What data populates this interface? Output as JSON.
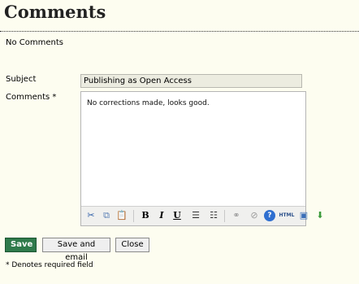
{
  "page": {
    "title": "Comments",
    "empty_message": "No Comments"
  },
  "form": {
    "subject_label": "Subject",
    "subject_value": "Publishing as Open Access",
    "comments_label": "Comments *",
    "comments_value": "No corrections made, looks good."
  },
  "editor_toolbar": {
    "buttons": [
      {
        "name": "cut",
        "icon": "scissors-icon",
        "glyph": "✂",
        "color": "#2f5fa8"
      },
      {
        "name": "copy",
        "icon": "copy-icon",
        "glyph": "⧉",
        "color": "#5a7fb5"
      },
      {
        "name": "paste",
        "icon": "paste-icon",
        "glyph": "📋",
        "color": "#b08a3a"
      },
      {
        "name": "bold",
        "icon": "bold-icon",
        "glyph": "B",
        "color": "#000000"
      },
      {
        "name": "italic",
        "icon": "italic-icon",
        "glyph": "I",
        "color": "#000000"
      },
      {
        "name": "underline",
        "icon": "underline-icon",
        "glyph": "U",
        "color": "#000000"
      },
      {
        "name": "bullet-list",
        "icon": "bullet-list-icon",
        "glyph": "☰",
        "color": "#333333"
      },
      {
        "name": "numbered-list",
        "icon": "numbered-list-icon",
        "glyph": "☷",
        "color": "#333333"
      },
      {
        "name": "link",
        "icon": "link-icon",
        "glyph": "⚭",
        "color": "#9a9a9a"
      },
      {
        "name": "unlink",
        "icon": "unlink-icon",
        "glyph": "⊘",
        "color": "#9a9a9a"
      },
      {
        "name": "help",
        "icon": "help-icon",
        "glyph": "?",
        "color": "#2f6fd0"
      },
      {
        "name": "html",
        "icon": "html-icon",
        "glyph": "HTML",
        "color": "#2a4f8a"
      },
      {
        "name": "fullscreen",
        "icon": "fullscreen-icon",
        "glyph": "▣",
        "color": "#3a6fb8"
      },
      {
        "name": "insert-image",
        "icon": "insert-image-icon",
        "glyph": "⬇",
        "color": "#3a9a3a"
      }
    ]
  },
  "actions": {
    "save_label": "Save",
    "save_email_label": "Save and email",
    "close_label": "Close"
  },
  "footer": {
    "required_note": "* Denotes required field"
  },
  "colors": {
    "background": "#fdfdf0",
    "save_button": "#2f7a4b",
    "subject_field": "#ecece0"
  }
}
